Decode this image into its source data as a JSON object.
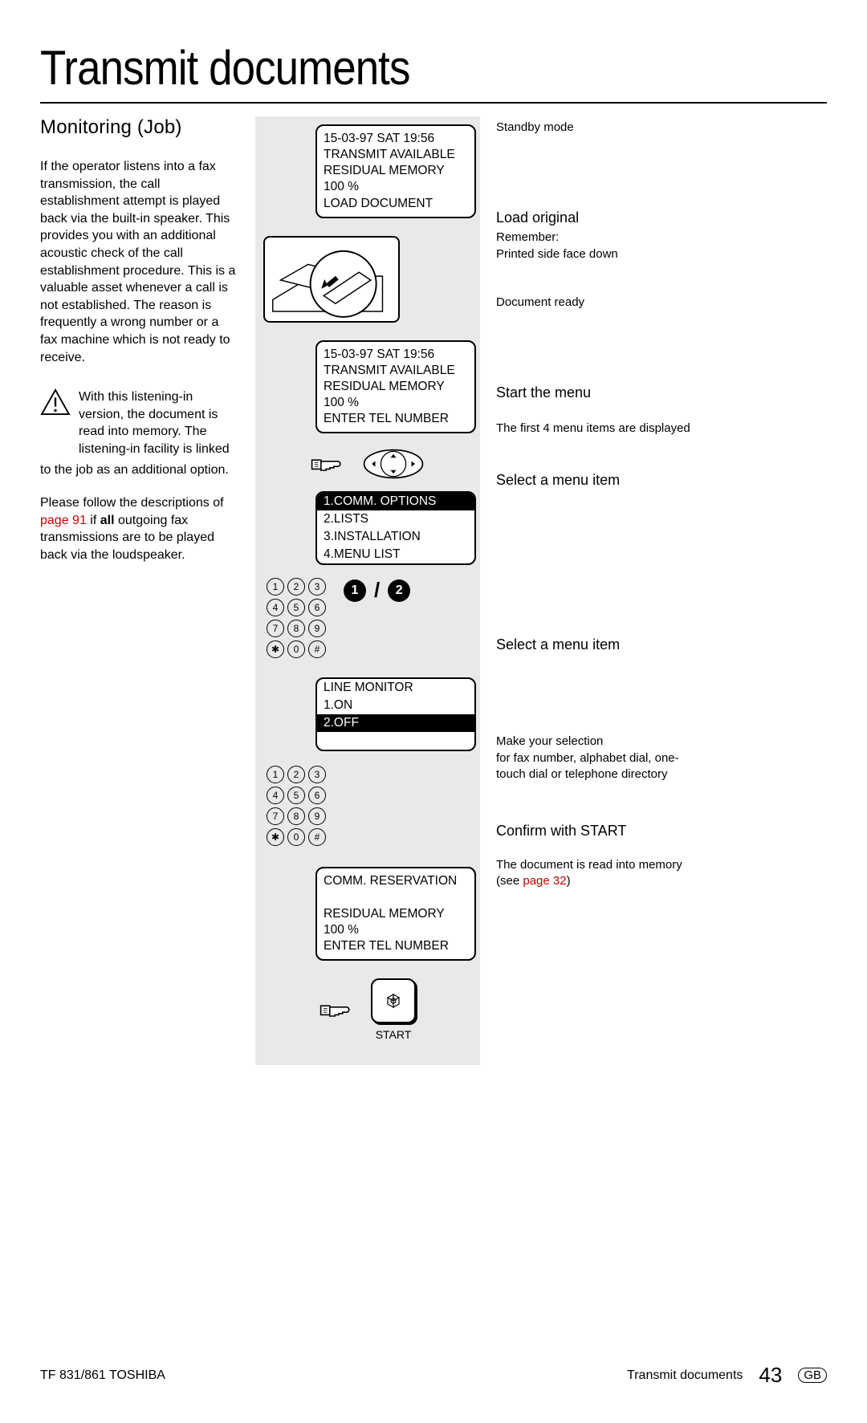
{
  "title": "Transmit documents",
  "subtitle": "Monitoring (Job)",
  "left": {
    "p1": "If the operator listens into a fax transmission, the call establishment attempt is played back via the built-in speaker. This provides you with an additional acoustic check of the call establishment procedure. This is a valuable asset whenever a call is not established. The reason is frequently a wrong number or a fax machine which is not ready to receive.",
    "warn": "With this listening-in version, the document is read into memory. The listening-in facility is linked",
    "warn_after": "to the job as an additional option.",
    "p2a": "Please follow the descriptions of ",
    "p2link": "page 91",
    "p2b": " if ",
    "p2bold": "all",
    "p2c": " outgoing fax transmissions are to be played back via the loudspeaker."
  },
  "lcd1": {
    "l1": "15-03-97    SAT    19:56",
    "l2": "TRANSMIT AVAILABLE",
    "l3": "RESIDUAL MEMORY 100 %",
    "l4": "LOAD DOCUMENT"
  },
  "lcd2": {
    "l1": "15-03-97    SAT    19:56",
    "l2": "TRANSMIT AVAILABLE",
    "l3": "RESIDUAL MEMORY 100 %",
    "l4": "ENTER TEL NUMBER"
  },
  "menu1": {
    "i1": "1.COMM. OPTIONS",
    "i2": "2.LISTS",
    "i3": "3.INSTALLATION",
    "i4": "4.MENU LIST"
  },
  "menu2": {
    "h": "LINE MONITOR",
    "i1": "1.ON",
    "i2": "2.OFF"
  },
  "lcd3": {
    "l1": "COMM. RESERVATION",
    "l2": "",
    "l3": "RESIDUAL MEMORY 100 %",
    "l4": "ENTER TEL NUMBER"
  },
  "keys": [
    "1",
    "2",
    "3",
    "4",
    "5",
    "6",
    "7",
    "8",
    "9",
    "✱",
    "0",
    "#"
  ],
  "bignums": {
    "a": "1",
    "b": "2"
  },
  "start_label": "START",
  "right": {
    "r1": "Standby mode",
    "r2h": "Load original",
    "r2a": "Remember:",
    "r2b": "Printed side face down",
    "r3": "Document ready",
    "r4h": "Start the menu",
    "r4t": "The first 4 menu items are displayed",
    "r5h": "Select a menu item",
    "r6h": "Select a menu item",
    "r7a": "Make your selection",
    "r7b": "for fax number, alphabet dial, one-touch dial or telephone directory",
    "r8h": "Confirm with START",
    "r8t": "The document is read into memory (see ",
    "r8link": "page 32",
    "r8end": ")"
  },
  "footer": {
    "left": "TF 831/861 TOSHIBA",
    "mid": "Transmit documents",
    "page": "43",
    "region": "GB"
  }
}
